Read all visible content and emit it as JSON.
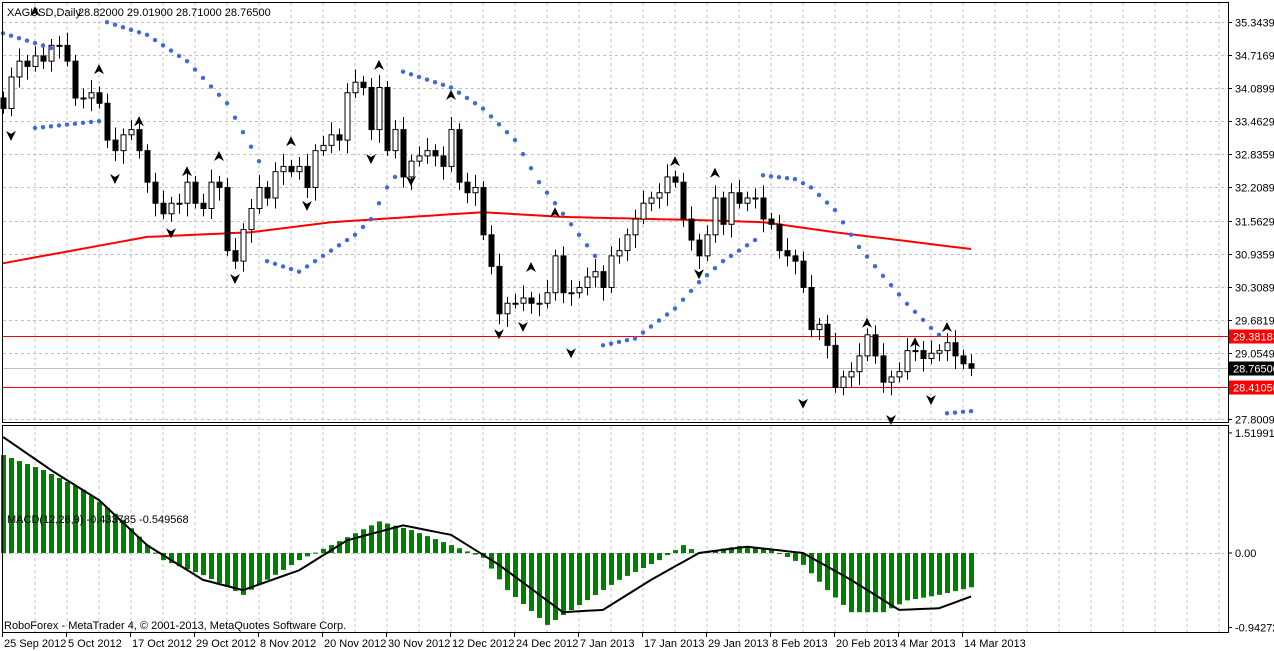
{
  "header": {
    "symbol": "XAGUSD,Daily",
    "ohlc": "28.82000 29.01900 28.71000 28.76500"
  },
  "macd_panel": {
    "label": "MACD(12,26,9) -0.433785 -0.549568",
    "axis_labels": [
      "1.519913",
      "0.00",
      "-0.942728"
    ]
  },
  "copyright": "RoboForex - MetaTrader 4, © 2001-2013, MetaQuotes Software Corp.",
  "colors": {
    "bull_fill": "#ffffff",
    "bear_fill": "#000000",
    "ma_line": "#ff0000",
    "sar_dots": "#4169e1",
    "macd_hist": "#008000",
    "macd_signal": "#000000",
    "level_line": "#ff0000",
    "bid_line": "#c0c0c0",
    "grid": "#c0c0c0"
  },
  "chart_data": {
    "type": "candlestick",
    "symbol": "XAGUSD",
    "timeframe": "Daily",
    "price_axis": {
      "ylim": [
        27.8009,
        35.3439
      ],
      "ticks": [
        "35.34390",
        "34.71690",
        "34.08990",
        "33.46290",
        "32.83590",
        "32.20890",
        "31.56290",
        "30.93590",
        "30.30890",
        "29.68190",
        "29.05490",
        "27.80090"
      ]
    },
    "price_markers": [
      {
        "label": "29.38183",
        "value": 29.38183,
        "bg": "#ff0000",
        "fg": "#ffffff",
        "line": "#ff0000"
      },
      {
        "label": "28.76500",
        "value": 28.765,
        "bg": "#000000",
        "fg": "#ffffff",
        "line": "#c0c0c0"
      },
      {
        "label": "28.41050",
        "value": 28.4105,
        "bg": "#ff0000",
        "fg": "#ffffff",
        "line": "#ff0000"
      }
    ],
    "x_labels": [
      {
        "bar": 0,
        "label": "25 Sep 2012"
      },
      {
        "bar": 8,
        "label": "5 Oct 2012"
      },
      {
        "bar": 16,
        "label": "17 Oct 2012"
      },
      {
        "bar": 24,
        "label": "29 Oct 2012"
      },
      {
        "bar": 32,
        "label": "8 Nov 2012"
      },
      {
        "bar": 40,
        "label": "20 Nov 2012"
      },
      {
        "bar": 48,
        "label": "30 Nov 2012"
      },
      {
        "bar": 56,
        "label": "12 Dec 2012"
      },
      {
        "bar": 64,
        "label": "24 Dec 2012"
      },
      {
        "bar": 72,
        "label": "7 Jan 2013"
      },
      {
        "bar": 80,
        "label": "17 Jan 2013"
      },
      {
        "bar": 88,
        "label": "29 Jan 2013"
      },
      {
        "bar": 96,
        "label": "8 Feb 2013"
      },
      {
        "bar": 104,
        "label": "20 Feb 2013"
      },
      {
        "bar": 112,
        "label": "4 Mar 2013"
      },
      {
        "bar": 120,
        "label": "14 Mar 2013"
      }
    ],
    "first_open": 33.9,
    "closes": [
      33.7,
      34.3,
      34.6,
      34.5,
      34.7,
      34.6,
      34.9,
      34.9,
      34.6,
      33.9,
      33.9,
      34.0,
      33.8,
      33.1,
      32.9,
      33.2,
      33.3,
      32.9,
      32.3,
      31.9,
      31.7,
      31.9,
      31.9,
      32.3,
      31.9,
      31.8,
      32.3,
      32.2,
      31.0,
      30.8,
      31.4,
      31.8,
      32.2,
      32.0,
      32.5,
      32.6,
      32.5,
      32.6,
      32.2,
      32.9,
      33.0,
      33.2,
      33.1,
      34.0,
      34.2,
      34.1,
      33.3,
      34.1,
      32.9,
      33.3,
      32.4,
      32.7,
      32.8,
      32.9,
      32.8,
      32.6,
      33.3,
      32.3,
      32.1,
      32.2,
      31.3,
      30.7,
      29.8,
      30.0,
      30.0,
      30.1,
      30.0,
      30.0,
      30.2,
      30.9,
      30.2,
      30.2,
      30.3,
      30.5,
      30.6,
      30.3,
      30.9,
      31.0,
      31.3,
      31.6,
      31.9,
      32.0,
      32.1,
      32.4,
      32.3,
      31.6,
      31.2,
      30.9,
      31.3,
      32.0,
      31.5,
      32.1,
      31.9,
      32.0,
      32.0,
      31.6,
      31.5,
      31.0,
      30.9,
      30.8,
      30.3,
      29.5,
      29.6,
      29.2,
      28.4,
      28.6,
      28.7,
      29.0,
      29.4,
      29.0,
      28.5,
      28.6,
      28.7,
      29.1,
      29.1,
      28.95,
      29.05,
      29.1,
      29.25,
      29.0,
      28.85,
      28.765
    ],
    "moving_average": [
      [
        0,
        30.76
      ],
      [
        18,
        31.26
      ],
      [
        31,
        31.35
      ],
      [
        41,
        31.54
      ],
      [
        60,
        31.73
      ],
      [
        70,
        31.64
      ],
      [
        87,
        31.58
      ],
      [
        95,
        31.54
      ],
      [
        104,
        31.35
      ],
      [
        121,
        31.03
      ]
    ],
    "parabolic_sar": [
      {
        "side": "above",
        "points": [
          [
            0,
            35.13
          ],
          [
            6,
            34.85
          ]
        ]
      },
      {
        "side": "below",
        "points": [
          [
            4,
            33.33
          ],
          [
            12,
            33.46
          ]
        ]
      },
      {
        "side": "above",
        "points": [
          [
            13,
            35.34
          ],
          [
            18,
            35.1
          ],
          [
            23,
            34.6
          ],
          [
            28,
            33.8
          ],
          [
            32,
            32.7
          ]
        ]
      },
      {
        "side": "below",
        "points": [
          [
            33,
            30.8
          ],
          [
            37,
            30.6
          ],
          [
            44,
            31.3
          ],
          [
            46,
            31.6
          ],
          [
            48,
            32.2
          ],
          [
            49,
            32.4
          ]
        ]
      },
      {
        "side": "above",
        "points": [
          [
            50,
            34.4
          ],
          [
            56,
            34.1
          ],
          [
            60,
            33.7
          ],
          [
            64,
            33.1
          ],
          [
            67,
            32.3
          ],
          [
            69,
            31.9
          ],
          [
            72,
            31.3
          ],
          [
            74,
            30.9
          ]
        ]
      },
      {
        "side": "below",
        "points": [
          [
            75,
            29.2
          ],
          [
            79,
            29.33
          ],
          [
            84,
            29.9
          ],
          [
            87,
            30.4
          ],
          [
            90,
            30.8
          ],
          [
            93,
            31.1
          ],
          [
            94,
            31.2
          ]
        ]
      },
      {
        "side": "above",
        "points": [
          [
            95,
            32.43
          ],
          [
            99,
            32.36
          ],
          [
            101,
            32.2
          ],
          [
            104,
            31.77
          ],
          [
            107,
            31.07
          ],
          [
            110,
            30.52
          ],
          [
            113,
            29.99
          ],
          [
            116,
            29.53
          ],
          [
            117,
            29.4
          ]
        ]
      },
      {
        "side": "below",
        "points": [
          [
            118,
            27.91
          ],
          [
            121,
            27.95
          ]
        ]
      }
    ],
    "fractals_up": [
      [
        4,
        35.53
      ],
      [
        12,
        34.43
      ],
      [
        17,
        33.44
      ],
      [
        23,
        32.49
      ],
      [
        27,
        32.78
      ],
      [
        36,
        33.06
      ],
      [
        47,
        34.51
      ],
      [
        56,
        33.94
      ],
      [
        66,
        30.67
      ],
      [
        69,
        31.71
      ],
      [
        84,
        32.68
      ],
      [
        89,
        32.46
      ],
      [
        108,
        29.61
      ],
      [
        114,
        29.24
      ],
      [
        118,
        29.53
      ]
    ],
    "fractals_down": [
      [
        1,
        33.2
      ],
      [
        14,
        32.38
      ],
      [
        21,
        31.35
      ],
      [
        29,
        30.48
      ],
      [
        38,
        31.87
      ],
      [
        46,
        32.76
      ],
      [
        51,
        32.34
      ],
      [
        62,
        29.43
      ],
      [
        65,
        29.57
      ],
      [
        71,
        29.07
      ],
      [
        87,
        30.57
      ],
      [
        100,
        28.11
      ],
      [
        111,
        27.8
      ],
      [
        116,
        28.18
      ]
    ],
    "macd": {
      "ylim": [
        -0.942728,
        1.519913
      ],
      "histogram": [
        [
          0,
          1.24
        ],
        [
          5,
          1.05
        ],
        [
          10,
          0.8
        ],
        [
          15,
          0.42
        ],
        [
          18,
          0.1
        ],
        [
          20,
          -0.09
        ],
        [
          25,
          -0.28
        ],
        [
          30,
          -0.53
        ],
        [
          32,
          -0.4
        ],
        [
          37,
          -0.09
        ],
        [
          41,
          0.1
        ],
        [
          47,
          0.4
        ],
        [
          51,
          0.29
        ],
        [
          56,
          0.1
        ],
        [
          60,
          -0.06
        ],
        [
          63,
          -0.47
        ],
        [
          68,
          -0.91
        ],
        [
          72,
          -0.66
        ],
        [
          77,
          -0.34
        ],
        [
          82,
          -0.09
        ],
        [
          85,
          0.1
        ],
        [
          87,
          0
        ],
        [
          92,
          0.09
        ],
        [
          96,
          0.05
        ],
        [
          100,
          -0.15
        ],
        [
          103,
          -0.47
        ],
        [
          106,
          -0.75
        ],
        [
          110,
          -0.75
        ],
        [
          113,
          -0.6
        ],
        [
          117,
          -0.53
        ],
        [
          121,
          -0.434
        ]
      ],
      "signal": [
        [
          0,
          1.47
        ],
        [
          6,
          1.05
        ],
        [
          12,
          0.67
        ],
        [
          18,
          0.1
        ],
        [
          25,
          -0.34
        ],
        [
          30,
          -0.47
        ],
        [
          37,
          -0.22
        ],
        [
          43,
          0.16
        ],
        [
          50,
          0.35
        ],
        [
          56,
          0.23
        ],
        [
          62,
          -0.15
        ],
        [
          70,
          -0.75
        ],
        [
          75,
          -0.72
        ],
        [
          81,
          -0.34
        ],
        [
          87,
          0
        ],
        [
          93,
          0.08
        ],
        [
          100,
          0
        ],
        [
          106,
          -0.34
        ],
        [
          112,
          -0.72
        ],
        [
          117,
          -0.7
        ],
        [
          121,
          -0.55
        ]
      ]
    }
  }
}
